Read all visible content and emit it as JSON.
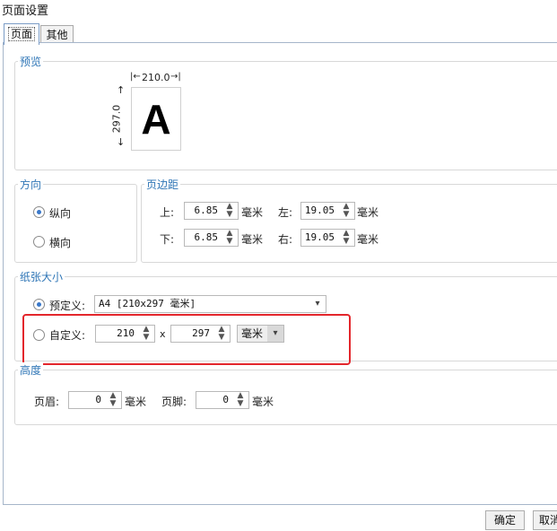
{
  "window": {
    "title": "页面设置"
  },
  "tabs": [
    {
      "label": "页面"
    },
    {
      "label": "其他"
    }
  ],
  "preview": {
    "title": "预览",
    "width_label": "210.0",
    "height_label": "297.0",
    "sample_letter": "A"
  },
  "orientation": {
    "title": "方向",
    "options": [
      {
        "label": "纵向",
        "checked": true
      },
      {
        "label": "横向",
        "checked": false
      }
    ]
  },
  "margins": {
    "title": "页边距",
    "top": {
      "label": "上:",
      "value": "6.85",
      "unit": "毫米"
    },
    "bottom": {
      "label": "下:",
      "value": "6.85",
      "unit": "毫米"
    },
    "left": {
      "label": "左:",
      "value": "19.05",
      "unit": "毫米"
    },
    "right": {
      "label": "右:",
      "value": "19.05",
      "unit": "毫米"
    }
  },
  "paper_size": {
    "title": "纸张大小",
    "predefined": {
      "label": "预定义:",
      "checked": true,
      "value": "A4 [210x297 毫米]"
    },
    "custom": {
      "label": "自定义:",
      "checked": false,
      "width": "210",
      "separator": "x",
      "height": "297",
      "unit": "毫米"
    }
  },
  "height_section": {
    "title": "高度",
    "header": {
      "label": "页眉:",
      "value": "0",
      "unit": "毫米"
    },
    "footer": {
      "label": "页脚:",
      "value": "0",
      "unit": "毫米"
    }
  },
  "buttons": {
    "ok": "确定",
    "cancel": "取消"
  },
  "icons": {
    "spin_up": "▲",
    "spin_down": "▼",
    "dropdown": "▾",
    "dim_left": "|←",
    "dim_right": "→|",
    "dim_up": "↑",
    "dim_down": "↓"
  },
  "colors": {
    "group_title": "#2e75b6",
    "highlight": "#e3262c",
    "radio_dot": "#3a78c9"
  }
}
